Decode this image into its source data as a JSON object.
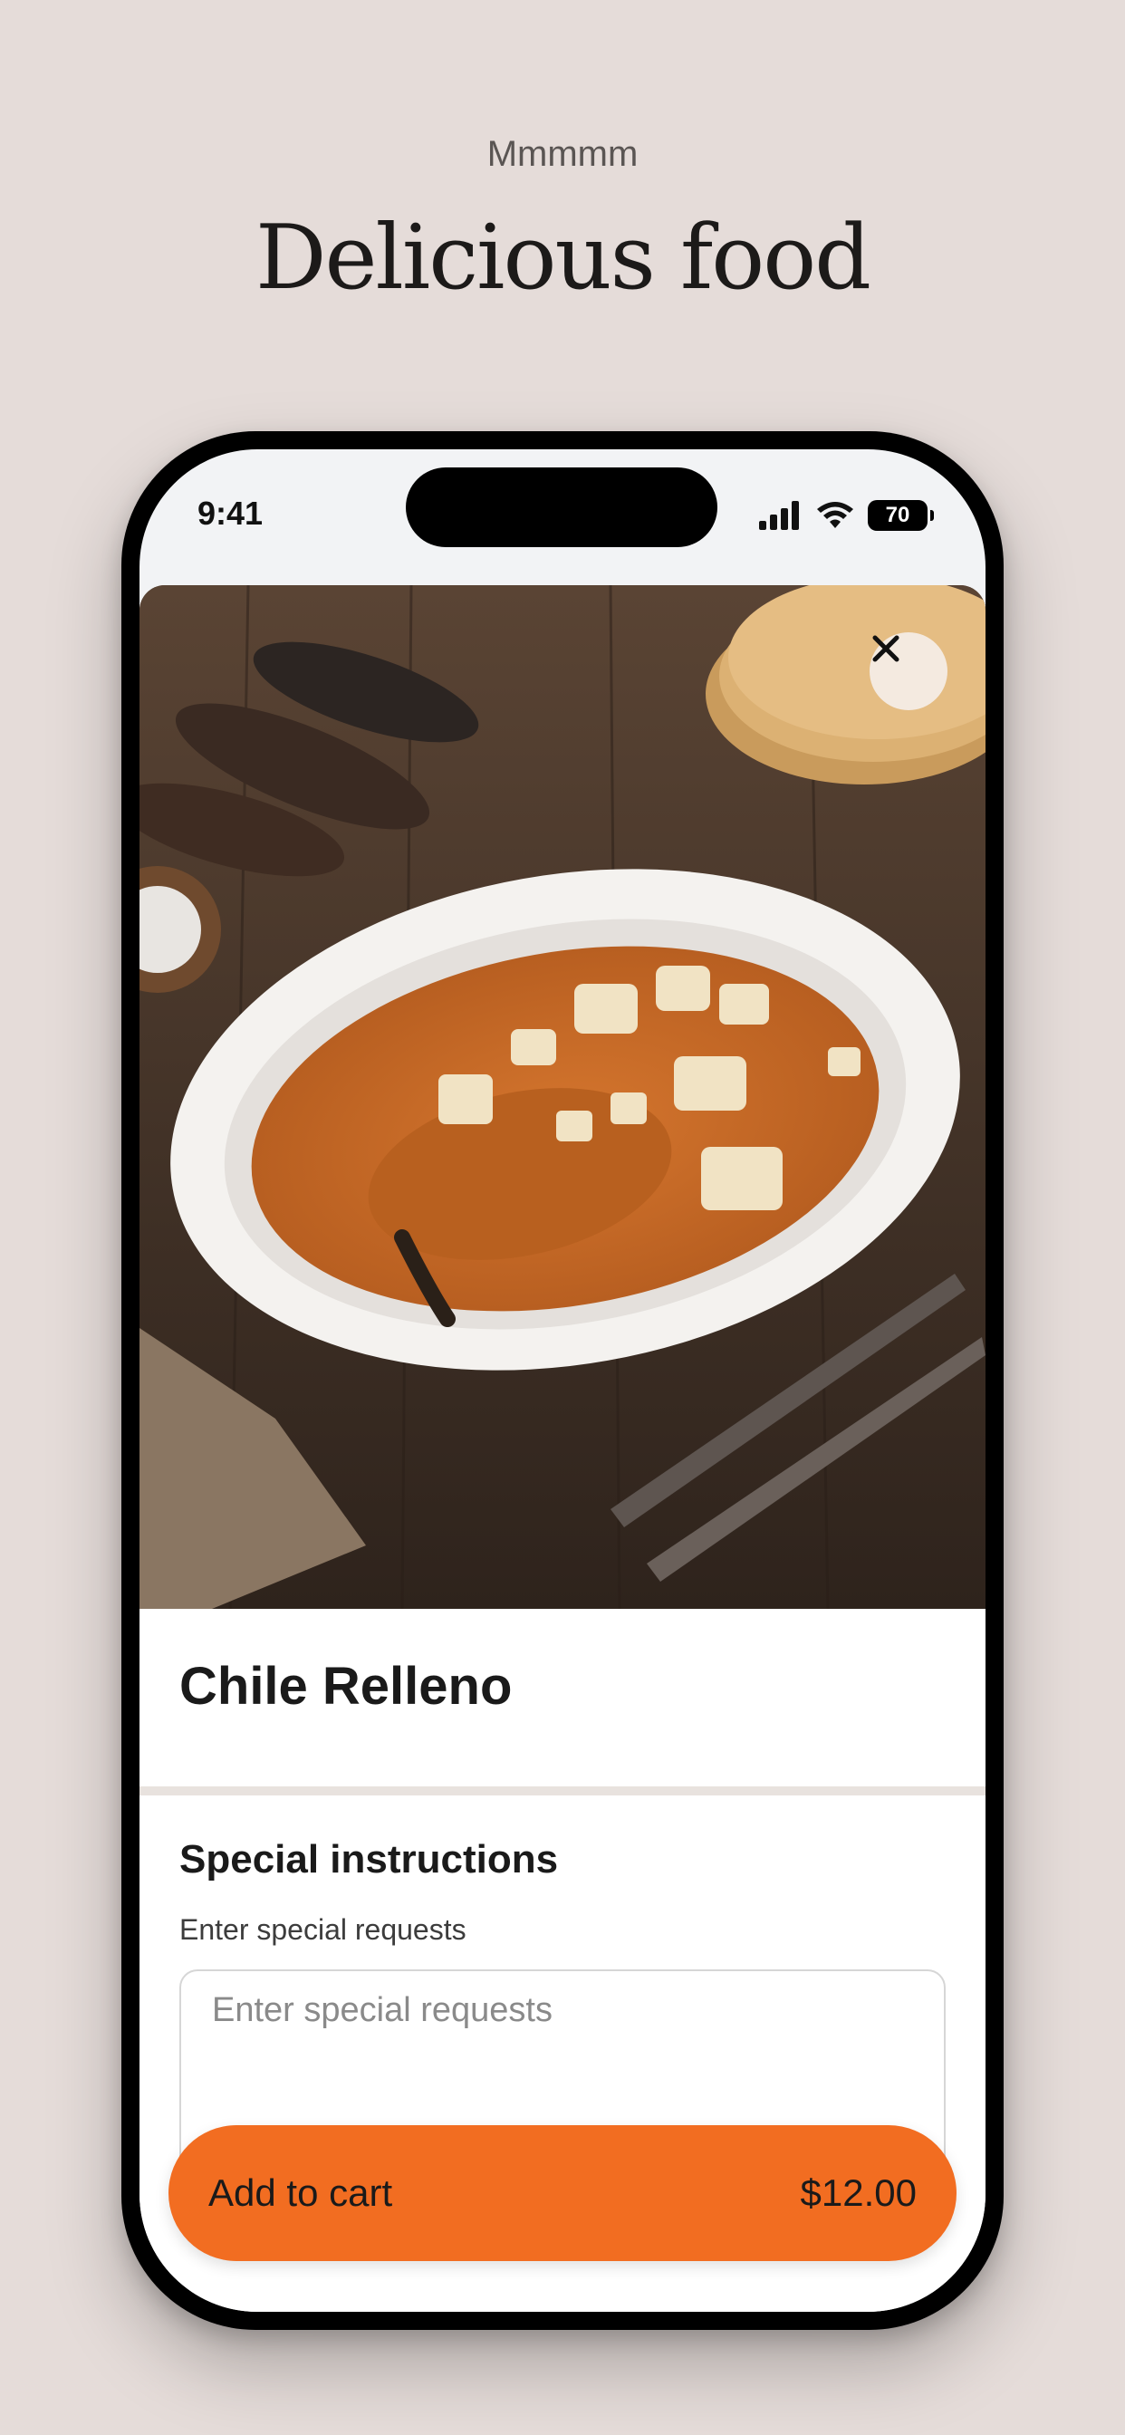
{
  "header": {
    "eyebrow": "Mmmmm",
    "headline": "Delicious food"
  },
  "status_bar": {
    "time": "9:41",
    "battery": "70"
  },
  "item": {
    "image_alt": "Chile Relleno plate",
    "name": "Chile Relleno"
  },
  "special_instructions": {
    "title": "Special instructions",
    "subtitle": "Enter special requests",
    "placeholder": "Enter special requests"
  },
  "cta": {
    "label": "Add to cart",
    "price": "$12.00"
  },
  "icons": [
    "signal-icon",
    "wifi-icon",
    "battery-icon",
    "close-icon"
  ],
  "colors": {
    "background": "#e5dcd9",
    "accent": "#f26d21"
  }
}
